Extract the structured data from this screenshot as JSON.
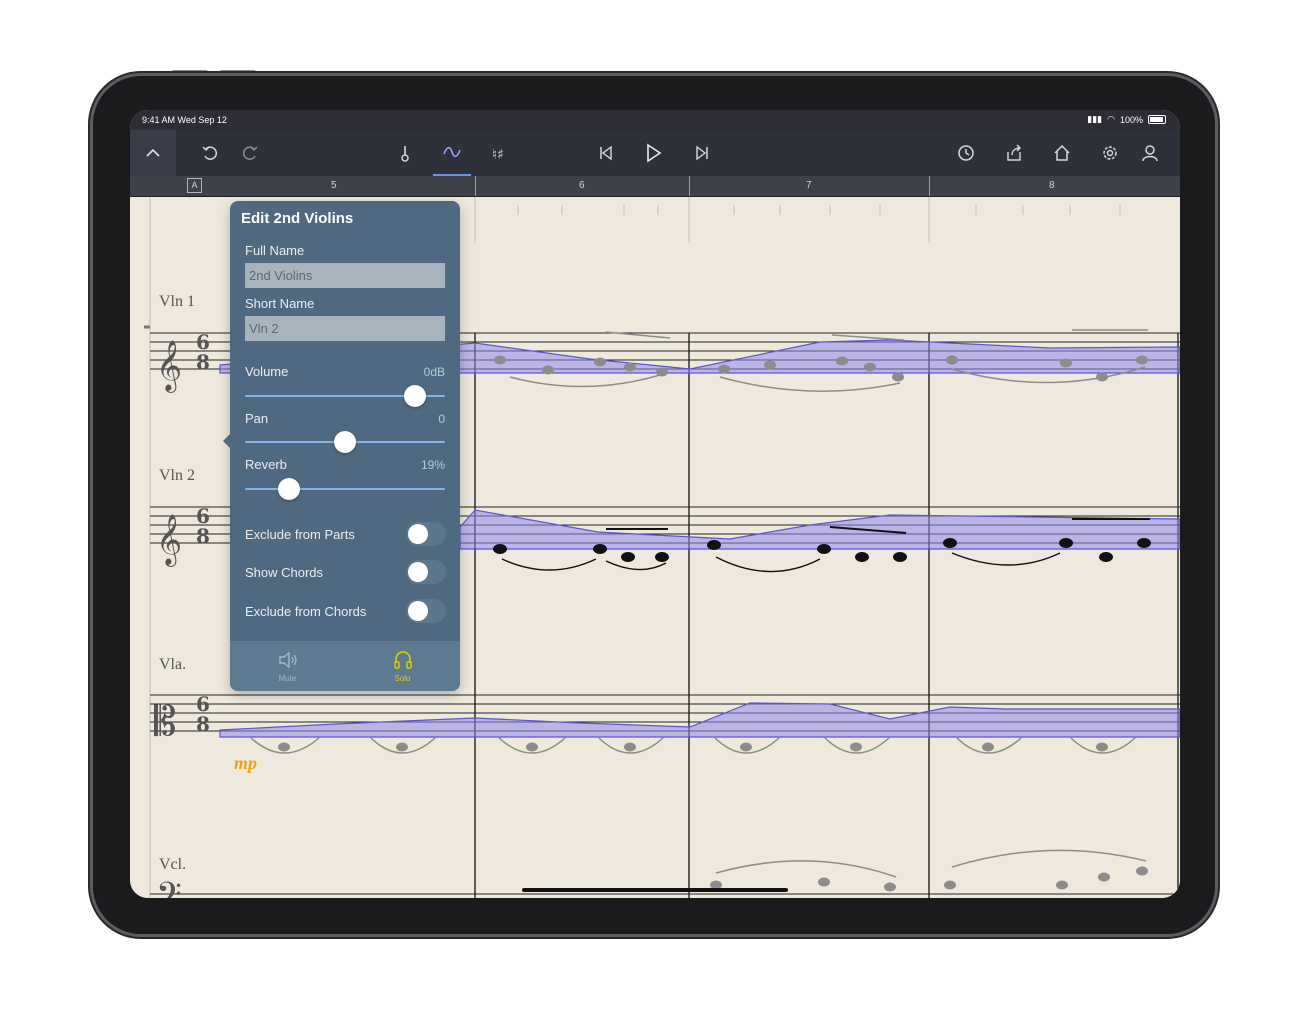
{
  "status": {
    "time_date": "9:41 AM  Wed Sep 12",
    "battery": "100%"
  },
  "toolbar": {
    "icons": [
      "chevron-up-icon",
      "undo-icon",
      "redo-icon",
      "thermometer-icon",
      "automation-curve-icon",
      "chord-icon",
      "skip-back-icon",
      "play-icon",
      "skip-forward-icon",
      "history-icon",
      "share-icon",
      "home-icon",
      "gear-icon",
      "account-icon"
    ],
    "accent": "#6f8ee8"
  },
  "ruler": {
    "rehearsal_mark": "A",
    "measures": [
      "5",
      "6",
      "7",
      "8"
    ]
  },
  "score": {
    "staves": [
      "Vln 1",
      "Vln 2",
      "Vla.",
      "Vcl."
    ],
    "dynamic": "mp",
    "automation_color": "#7c74e6"
  },
  "panel": {
    "title": "Edit 2nd Violins",
    "full_name_label": "Full Name",
    "full_name_value": "2nd Violins",
    "short_name_label": "Short Name",
    "short_name_value": "Vln 2",
    "volume_label": "Volume",
    "volume_value": "0dB",
    "volume_level": 0.85,
    "pan_label": "Pan",
    "pan_value": "0",
    "pan_level": 0.5,
    "reverb_label": "Reverb",
    "reverb_value": "19%",
    "reverb_level": 0.22,
    "toggles": [
      {
        "label": "Exclude from Parts",
        "on": false
      },
      {
        "label": "Show Chords",
        "on": false
      },
      {
        "label": "Exclude from Chords",
        "on": false
      }
    ],
    "mute_label": "Mute",
    "solo_label": "Solo",
    "solo_color": "#d8d400"
  }
}
